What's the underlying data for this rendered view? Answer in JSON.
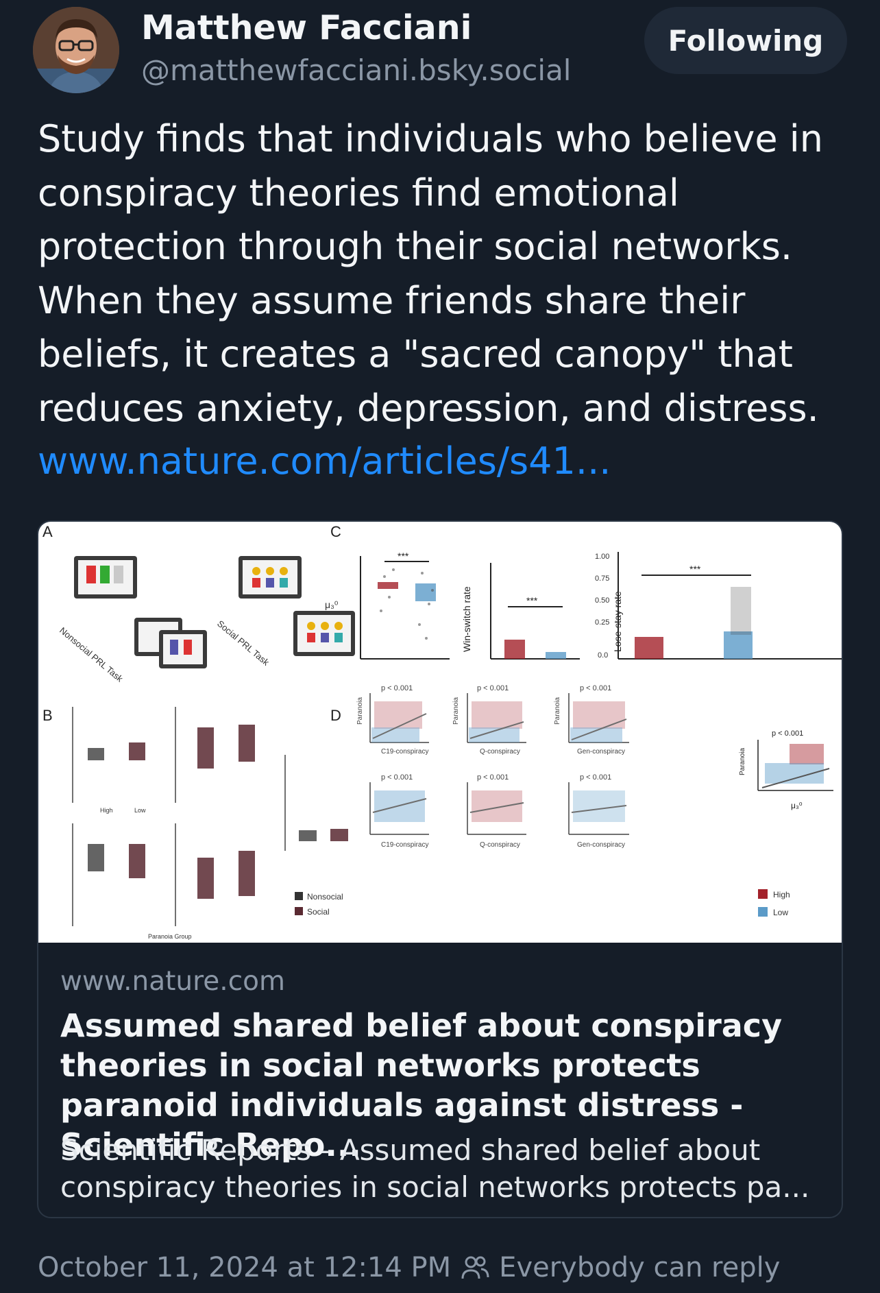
{
  "author": {
    "name": "Matthew Facciani",
    "handle": "@matthewfacciani.bsky.social",
    "follow_label": "Following"
  },
  "post": {
    "text_lines": [
      "Study finds that individuals who believe in",
      "conspiracy theories find emotional",
      "protection through their social networks.",
      "When they assume friends share their",
      "beliefs, it creates a \"sacred canopy\" that",
      "reduces anxiety, depression, and distress."
    ],
    "link_text": "www.nature.com/articles/s41..."
  },
  "card": {
    "domain": "www.nature.com",
    "title": "Assumed shared belief about conspiracy theories in social networks protects paranoid individuals against distress - Scientific Repo...",
    "description": "Scientific Reports - Assumed shared belief about conspiracy theories in social networks protects pa...",
    "figure": {
      "panel_a": "A",
      "panel_b": "B",
      "panel_c": "C",
      "panel_d": "D",
      "nonsocial_task": "Nonsocial PRL Task",
      "social_task": "Social PRL Task",
      "sig_marker": "***",
      "win_switch_label": "Win-switch rate",
      "lose_stay_label": "Lose-stay rate",
      "mu_label": "μ₃⁰",
      "p_label": "p < 0.001",
      "paranoia_label": "Paranoia",
      "x_c19": "C19-conspiracy",
      "x_q": "Q-conspiracy",
      "x_gen": "Gen-conspiracy",
      "legend_nonsocial": "Nonsocial",
      "legend_social": "Social",
      "legend_high": "High",
      "legend_low": "Low",
      "group_high": "High",
      "group_low": "Low",
      "paranoia_group": "Paranoia Group",
      "tick_100": "1.00",
      "tick_075": "0.75",
      "tick_050": "0.50",
      "tick_025": "0.25",
      "tick_00": "0.0",
      "colors": {
        "high": "#a3222b",
        "low": "#5b9bc8",
        "nonsocial": "#333333",
        "social": "#5a2a32"
      }
    }
  },
  "footer": {
    "timestamp": "October 11, 2024 at 12:14 PM",
    "reply_setting": "Everybody can reply"
  }
}
